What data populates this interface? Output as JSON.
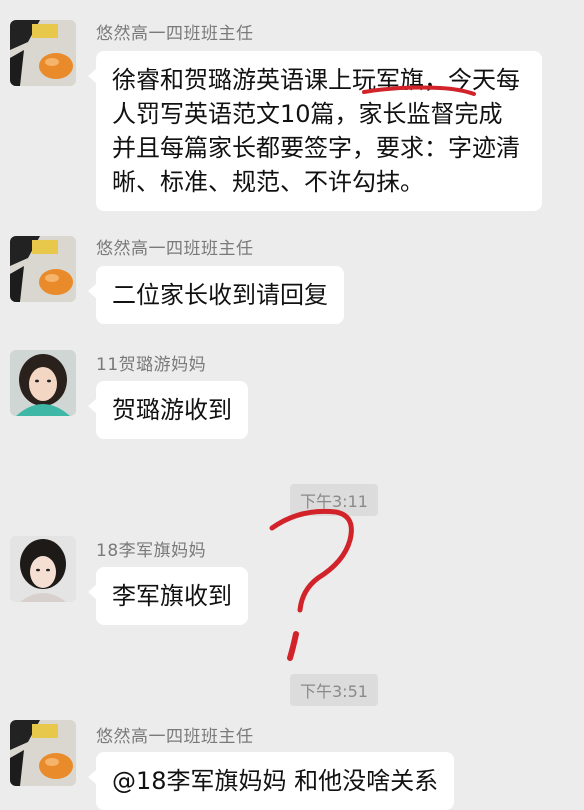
{
  "messages": [
    {
      "sender": "悠然高一四班班主任",
      "avatar_icon": "egg-avatar",
      "text": "徐睿和贺璐游英语课上玩军旗，今天每人罚写英语范文10篇，家长监督完成并且每篇家长都要签字，要求：字迹清晰、标准、规范、不许勾抹。"
    },
    {
      "sender": "悠然高一四班班主任",
      "avatar_icon": "egg-avatar",
      "text": "二位家长收到请回复"
    },
    {
      "sender": "11贺璐游妈妈",
      "avatar_icon": "woman-portrait-avatar",
      "text": "贺璐游收到"
    },
    {
      "sender": "18李军旗妈妈",
      "avatar_icon": "woman-portrait-avatar",
      "text": "李军旗收到"
    },
    {
      "sender": "悠然高一四班班主任",
      "avatar_icon": "egg-avatar",
      "text": "@18李军旗妈妈 和他没啥关系"
    }
  ],
  "timestamps": [
    "下午3:11",
    "下午3:51"
  ],
  "annotation": {
    "mark": "?",
    "color": "#d2232a"
  }
}
